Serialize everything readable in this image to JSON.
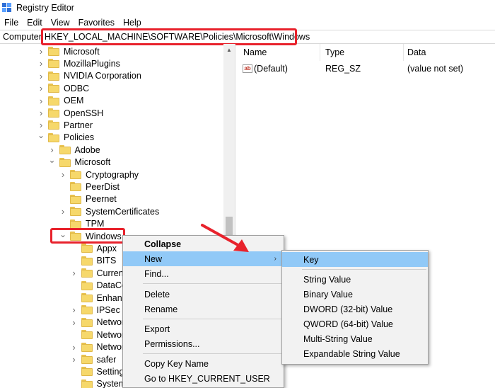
{
  "window": {
    "title": "Registry Editor"
  },
  "menubar": [
    "File",
    "Edit",
    "View",
    "Favorites",
    "Help"
  ],
  "address": {
    "label": "Computer",
    "path": "HKEY_LOCAL_MACHINE\\SOFTWARE\\Policies\\Microsoft\\Windows"
  },
  "tree": [
    {
      "label": "Microsoft",
      "level": 0,
      "expand": "collapsed"
    },
    {
      "label": "MozillaPlugins",
      "level": 0,
      "expand": "collapsed"
    },
    {
      "label": "NVIDIA Corporation",
      "level": 0,
      "expand": "collapsed"
    },
    {
      "label": "ODBC",
      "level": 0,
      "expand": "collapsed"
    },
    {
      "label": "OEM",
      "level": 0,
      "expand": "collapsed"
    },
    {
      "label": "OpenSSH",
      "level": 0,
      "expand": "collapsed"
    },
    {
      "label": "Partner",
      "level": 0,
      "expand": "collapsed"
    },
    {
      "label": "Policies",
      "level": 0,
      "expand": "expanded"
    },
    {
      "label": "Adobe",
      "level": 1,
      "expand": "collapsed"
    },
    {
      "label": "Microsoft",
      "level": 1,
      "expand": "expanded"
    },
    {
      "label": "Cryptography",
      "level": 2,
      "expand": "collapsed"
    },
    {
      "label": "PeerDist",
      "level": 2,
      "expand": "none"
    },
    {
      "label": "Peernet",
      "level": 2,
      "expand": "none"
    },
    {
      "label": "SystemCertificates",
      "level": 2,
      "expand": "collapsed"
    },
    {
      "label": "TPM",
      "level": 2,
      "expand": "none"
    },
    {
      "label": "Windows",
      "level": 2,
      "expand": "expanded"
    },
    {
      "label": "Appx",
      "level": 3,
      "expand": "none"
    },
    {
      "label": "BITS",
      "level": 3,
      "expand": "none"
    },
    {
      "label": "Current",
      "level": 3,
      "expand": "collapsed"
    },
    {
      "label": "DataCo",
      "level": 3,
      "expand": "none"
    },
    {
      "label": "Enhanc",
      "level": 3,
      "expand": "none"
    },
    {
      "label": "IPSec",
      "level": 3,
      "expand": "collapsed"
    },
    {
      "label": "Networ",
      "level": 3,
      "expand": "collapsed"
    },
    {
      "label": "Networ",
      "level": 3,
      "expand": "none"
    },
    {
      "label": "Networ",
      "level": 3,
      "expand": "collapsed"
    },
    {
      "label": "safer",
      "level": 3,
      "expand": "collapsed"
    },
    {
      "label": "SettingS",
      "level": 3,
      "expand": "none"
    },
    {
      "label": "System",
      "level": 3,
      "expand": "none"
    }
  ],
  "list": {
    "headers": {
      "name": "Name",
      "type": "Type",
      "data": "Data"
    },
    "rows": [
      {
        "name": "(Default)",
        "type": "REG_SZ",
        "data": "(value not set)",
        "icon": "ab"
      }
    ]
  },
  "context_menu": [
    {
      "label": "Collapse",
      "bold": true
    },
    {
      "label": "New",
      "submenu": true,
      "highlighted": true
    },
    {
      "label": "Find..."
    },
    {
      "label": "Delete"
    },
    {
      "label": "Rename"
    },
    {
      "label": "Export"
    },
    {
      "label": "Permissions..."
    },
    {
      "label": "Copy Key Name"
    },
    {
      "label": "Go to HKEY_CURRENT_USER"
    }
  ],
  "sub_menu": [
    {
      "label": "Key",
      "highlighted": true
    },
    {
      "label": "String Value"
    },
    {
      "label": "Binary Value"
    },
    {
      "label": "DWORD (32-bit) Value"
    },
    {
      "label": "QWORD (64-bit) Value"
    },
    {
      "label": "Multi-String Value"
    },
    {
      "label": "Expandable String Value"
    }
  ],
  "colors": {
    "highlight": "#91c9f7",
    "annotation": "#e8222c",
    "folder": "#f6d86b"
  }
}
